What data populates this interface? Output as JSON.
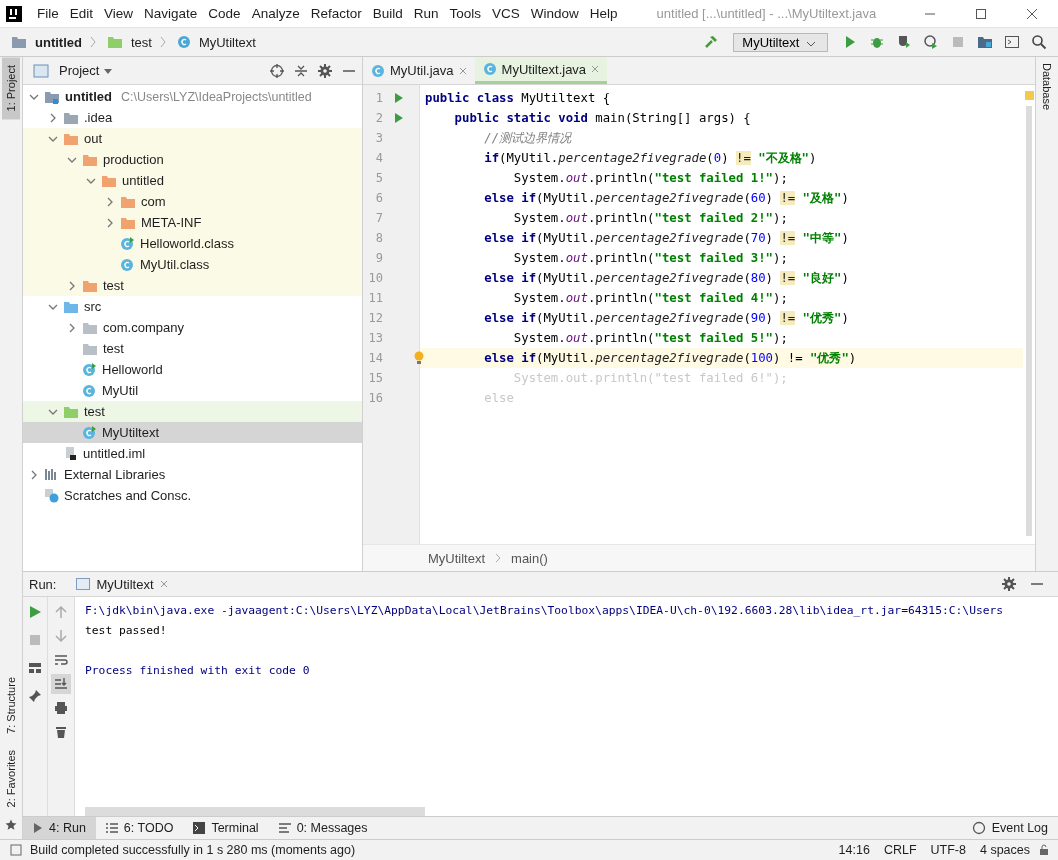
{
  "menu": [
    "File",
    "Edit",
    "View",
    "Navigate",
    "Code",
    "Analyze",
    "Refactor",
    "Build",
    "Run",
    "Tools",
    "VCS",
    "Window",
    "Help"
  ],
  "window": {
    "title": "untitled [...\\untitled] - ...\\MyUtiltext.java"
  },
  "breadcrumbs": [
    {
      "label": "untitled",
      "kind": "module"
    },
    {
      "label": "test",
      "kind": "test"
    },
    {
      "label": "MyUtiltext",
      "kind": "class"
    }
  ],
  "run_config": {
    "label": "MyUtiltext"
  },
  "left_strip": {
    "top": [
      {
        "label": "1: Project",
        "selected": true
      }
    ],
    "bottom": [
      {
        "label": "7: Structure",
        "selected": false
      },
      {
        "label": "2: Favorites",
        "selected": false
      }
    ]
  },
  "project_panel": {
    "title": "Project"
  },
  "tree": [
    {
      "label": "untitled",
      "hint": "C:\\Users\\LYZ\\IdeaProjects\\untitled",
      "kind": "module",
      "expanded": true,
      "selected": false,
      "children": [
        {
          "label": ".idea",
          "kind": "folder",
          "expanded": false,
          "selected": false
        },
        {
          "label": "out",
          "kind": "excluded",
          "expanded": true,
          "selected": false,
          "children": [
            {
              "label": "production",
              "kind": "excluded",
              "expanded": true,
              "selected": false,
              "children": [
                {
                  "label": "untitled",
                  "kind": "excluded",
                  "expanded": true,
                  "selected": false,
                  "children": [
                    {
                      "label": "com",
                      "kind": "excluded",
                      "expanded": false,
                      "selected": false
                    },
                    {
                      "label": "META-INF",
                      "kind": "excluded",
                      "expanded": false,
                      "selected": false
                    },
                    {
                      "label": "Helloworld.class",
                      "kind": "runnable",
                      "selected": false
                    },
                    {
                      "label": "MyUtil.class",
                      "kind": "class",
                      "selected": false
                    }
                  ]
                }
              ]
            },
            {
              "label": "test",
              "kind": "excluded",
              "expanded": false,
              "selected": false
            }
          ]
        },
        {
          "label": "src",
          "kind": "source",
          "expanded": true,
          "selected": false,
          "children": [
            {
              "label": "com.company",
              "kind": "package",
              "expanded": false,
              "selected": false
            },
            {
              "label": "test",
              "kind": "package",
              "selected": false
            },
            {
              "label": "Helloworld",
              "kind": "runnable",
              "selected": false
            },
            {
              "label": "MyUtil",
              "kind": "class",
              "selected": false
            }
          ]
        },
        {
          "label": "test",
          "kind": "test",
          "expanded": true,
          "selected": false,
          "children": [
            {
              "label": "MyUtiltext",
              "kind": "runnable",
              "selected": true
            }
          ]
        },
        {
          "label": "untitled.iml",
          "kind": "file",
          "selected": false
        }
      ]
    },
    {
      "label": "External Libraries",
      "kind": "libraries",
      "expanded": false,
      "selected": false
    },
    {
      "label": "Scratches and Consc.",
      "kind": "scratches",
      "selected": false
    }
  ],
  "editor_tabs": [
    {
      "label": "MyUtil.java",
      "selected": false
    },
    {
      "label": "MyUtiltext.java",
      "selected": true
    }
  ],
  "code": [
    {
      "n": "1",
      "runnable": true,
      "intention": false,
      "current": false,
      "segs": [
        {
          "kind": "kw",
          "t": "public class "
        },
        {
          "kind": "text",
          "t": "MyUtiltext {"
        }
      ]
    },
    {
      "n": "2",
      "runnable": true,
      "intention": false,
      "current": false,
      "segs": [
        {
          "kind": "kw",
          "t": "    public static void "
        },
        {
          "kind": "text",
          "t": "main(String[] args) {"
        }
      ]
    },
    {
      "n": "3",
      "runnable": false,
      "intention": false,
      "current": false,
      "segs": [
        {
          "kind": "comment",
          "t": "        //测试边界情况"
        }
      ]
    },
    {
      "n": "4",
      "runnable": false,
      "intention": false,
      "current": false,
      "segs": [
        {
          "kind": "kw",
          "t": "        if"
        },
        {
          "kind": "text",
          "t": "(MyUtil."
        },
        {
          "kind": "method",
          "t": "percentage2fivegrade"
        },
        {
          "kind": "text",
          "t": "("
        },
        {
          "kind": "num",
          "t": "0"
        },
        {
          "kind": "text",
          "t": ") "
        },
        {
          "kind": "op",
          "t": "!="
        },
        {
          "kind": "str",
          "t": " \"不及格\""
        },
        {
          "kind": "text",
          "t": ")"
        }
      ]
    },
    {
      "n": "5",
      "runnable": false,
      "intention": false,
      "current": false,
      "segs": [
        {
          "kind": "text",
          "t": "            System."
        },
        {
          "kind": "static",
          "t": "out"
        },
        {
          "kind": "text",
          "t": ".println("
        },
        {
          "kind": "str",
          "t": "\"test failed 1!\""
        },
        {
          "kind": "text",
          "t": ");"
        }
      ]
    },
    {
      "n": "6",
      "runnable": false,
      "intention": false,
      "current": false,
      "segs": [
        {
          "kind": "kw",
          "t": "        else if"
        },
        {
          "kind": "text",
          "t": "(MyUtil."
        },
        {
          "kind": "method",
          "t": "percentage2fivegrade"
        },
        {
          "kind": "text",
          "t": "("
        },
        {
          "kind": "num",
          "t": "60"
        },
        {
          "kind": "text",
          "t": ") "
        },
        {
          "kind": "op",
          "t": "!="
        },
        {
          "kind": "str",
          "t": " \"及格\""
        },
        {
          "kind": "text",
          "t": ")"
        }
      ]
    },
    {
      "n": "7",
      "runnable": false,
      "intention": false,
      "current": false,
      "segs": [
        {
          "kind": "text",
          "t": "            System."
        },
        {
          "kind": "static",
          "t": "out"
        },
        {
          "kind": "text",
          "t": ".println("
        },
        {
          "kind": "str",
          "t": "\"test failed 2!\""
        },
        {
          "kind": "text",
          "t": ");"
        }
      ]
    },
    {
      "n": "8",
      "runnable": false,
      "intention": false,
      "current": false,
      "segs": [
        {
          "kind": "kw",
          "t": "        else if"
        },
        {
          "kind": "text",
          "t": "(MyUtil."
        },
        {
          "kind": "method",
          "t": "percentage2fivegrade"
        },
        {
          "kind": "text",
          "t": "("
        },
        {
          "kind": "num",
          "t": "70"
        },
        {
          "kind": "text",
          "t": ") "
        },
        {
          "kind": "op",
          "t": "!="
        },
        {
          "kind": "str",
          "t": " \"中等\""
        },
        {
          "kind": "text",
          "t": ")"
        }
      ]
    },
    {
      "n": "9",
      "runnable": false,
      "intention": false,
      "current": false,
      "segs": [
        {
          "kind": "text",
          "t": "            System."
        },
        {
          "kind": "static",
          "t": "out"
        },
        {
          "kind": "text",
          "t": ".println("
        },
        {
          "kind": "str",
          "t": "\"test failed 3!\""
        },
        {
          "kind": "text",
          "t": ");"
        }
      ]
    },
    {
      "n": "10",
      "runnable": false,
      "intention": false,
      "current": false,
      "segs": [
        {
          "kind": "kw",
          "t": "        else if"
        },
        {
          "kind": "text",
          "t": "(MyUtil."
        },
        {
          "kind": "method",
          "t": "percentage2fivegrade"
        },
        {
          "kind": "text",
          "t": "("
        },
        {
          "kind": "num",
          "t": "80"
        },
        {
          "kind": "text",
          "t": ") "
        },
        {
          "kind": "op",
          "t": "!="
        },
        {
          "kind": "str",
          "t": " \"良好\""
        },
        {
          "kind": "text",
          "t": ")"
        }
      ]
    },
    {
      "n": "11",
      "runnable": false,
      "intention": false,
      "current": false,
      "segs": [
        {
          "kind": "text",
          "t": "            System."
        },
        {
          "kind": "static",
          "t": "out"
        },
        {
          "kind": "text",
          "t": ".println("
        },
        {
          "kind": "str",
          "t": "\"test failed 4!\""
        },
        {
          "kind": "text",
          "t": ");"
        }
      ]
    },
    {
      "n": "12",
      "runnable": false,
      "intention": false,
      "current": false,
      "segs": [
        {
          "kind": "kw",
          "t": "        else if"
        },
        {
          "kind": "text",
          "t": "(MyUtil."
        },
        {
          "kind": "method",
          "t": "percentage2fivegrade"
        },
        {
          "kind": "text",
          "t": "("
        },
        {
          "kind": "num",
          "t": "90"
        },
        {
          "kind": "text",
          "t": ") "
        },
        {
          "kind": "op",
          "t": "!="
        },
        {
          "kind": "str",
          "t": " \"优秀\""
        },
        {
          "kind": "text",
          "t": ")"
        }
      ]
    },
    {
      "n": "13",
      "runnable": false,
      "intention": false,
      "current": false,
      "segs": [
        {
          "kind": "text",
          "t": "            System."
        },
        {
          "kind": "static",
          "t": "out"
        },
        {
          "kind": "text",
          "t": ".println("
        },
        {
          "kind": "str",
          "t": "\"test failed 5!\""
        },
        {
          "kind": "text",
          "t": ");"
        }
      ]
    },
    {
      "n": "14",
      "runnable": false,
      "intention": true,
      "current": true,
      "segs": [
        {
          "kind": "kw",
          "t": "        else if"
        },
        {
          "kind": "text",
          "t": "(MyUtil."
        },
        {
          "kind": "method",
          "t": "percentage2fivegrade"
        },
        {
          "kind": "text",
          "t": "("
        },
        {
          "kind": "num",
          "t": "100"
        },
        {
          "kind": "text",
          "t": ") !="
        },
        {
          "kind": "str",
          "t": " \"优秀\""
        },
        {
          "kind": "text",
          "t": ")"
        }
      ]
    },
    {
      "n": "15",
      "runnable": false,
      "intention": false,
      "current": false,
      "segs": [
        {
          "kind": "faded",
          "t": "            System.out.println(\"test failed 6!\");"
        }
      ]
    },
    {
      "n": "16",
      "runnable": false,
      "intention": false,
      "current": false,
      "segs": [
        {
          "kind": "faded",
          "t": "        else"
        }
      ]
    }
  ],
  "editor_breadcrumb": [
    "MyUtiltext",
    "main()"
  ],
  "right_strip": {
    "label": "Database"
  },
  "run_panel": {
    "title": "Run:",
    "tab": "MyUtiltext",
    "console": [
      {
        "kind": "command",
        "text": "F:\\jdk\\bin\\java.exe -javaagent:C:\\Users\\LYZ\\AppData\\Local\\JetBrains\\Toolbox\\apps\\IDEA-U\\ch-0\\192.6603.28\\lib\\idea_rt.jar=64315:C:\\Users"
      },
      {
        "kind": "output",
        "text": "test passed!"
      },
      {
        "kind": "system",
        "text": "Process finished with exit code 0"
      }
    ]
  },
  "tool_tabs": [
    {
      "label": "4: Run",
      "kind": "run",
      "selected": true
    },
    {
      "label": "6: TODO",
      "kind": "todo",
      "selected": false
    },
    {
      "label": "Terminal",
      "kind": "terminal",
      "selected": false
    },
    {
      "label": "0: Messages",
      "kind": "messages",
      "selected": false
    }
  ],
  "event_log": "Event Log",
  "status_bar": {
    "message": "Build completed successfully in 1 s 280 ms (moments ago)",
    "items": [
      "14:16",
      "CRLF",
      "UTF-8",
      "4 spaces"
    ]
  }
}
